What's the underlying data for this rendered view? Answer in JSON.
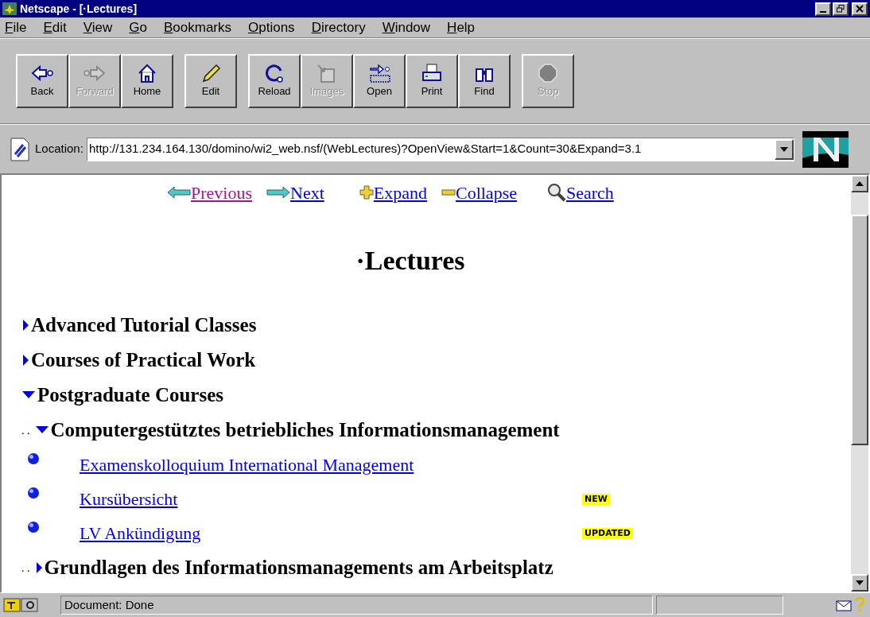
{
  "window": {
    "title": "Netscape - [·Lectures]"
  },
  "menu": [
    "File",
    "Edit",
    "View",
    "Go",
    "Bookmarks",
    "Options",
    "Directory",
    "Window",
    "Help"
  ],
  "toolbar": [
    {
      "kind": "back",
      "label": "Back",
      "disabled": false
    },
    {
      "kind": "forward",
      "label": "Forward",
      "disabled": true
    },
    {
      "kind": "home",
      "label": "Home",
      "disabled": false
    },
    {
      "kind": "edit",
      "label": "Edit",
      "disabled": false
    },
    {
      "kind": "reload",
      "label": "Reload",
      "disabled": false
    },
    {
      "kind": "images",
      "label": "Images",
      "disabled": true
    },
    {
      "kind": "open",
      "label": "Open",
      "disabled": false
    },
    {
      "kind": "print",
      "label": "Print",
      "disabled": false
    },
    {
      "kind": "find",
      "label": "Find",
      "disabled": false
    },
    {
      "kind": "stop",
      "label": "Stop",
      "disabled": true
    }
  ],
  "location": {
    "label": "Location:",
    "value": "http://131.234.164.130/domino/wi2_web.nsf/(WebLectures)?OpenView&Start=1&Count=30&Expand=3.1"
  },
  "nav_links": [
    {
      "kind": "previous",
      "label": "Previous",
      "visited": true
    },
    {
      "kind": "next",
      "label": "Next",
      "visited": false
    },
    {
      "kind": "expand",
      "label": "Expand",
      "visited": false
    },
    {
      "kind": "collapse",
      "label": "Collapse",
      "visited": false
    },
    {
      "kind": "search",
      "label": "Search",
      "visited": false
    }
  ],
  "page_title": "·Lectures",
  "tree": [
    {
      "kind": "category",
      "label": "Advanced Tutorial Classes",
      "expanded": false
    },
    {
      "kind": "category",
      "label": "Courses of Practical Work",
      "expanded": false
    },
    {
      "kind": "category",
      "label": "Postgraduate Courses",
      "expanded": true,
      "children": [
        {
          "kind": "category",
          "leader": ". .",
          "label": "Computergestütztes betriebliches Informationsmanagement",
          "expanded": true,
          "children": [
            {
              "kind": "document",
              "label": "Examenskolloquium International Management"
            },
            {
              "kind": "document",
              "label": "Kursübersicht",
              "badge": "NEW"
            },
            {
              "kind": "document",
              "label": "LV Ankündigung",
              "badge": "UPDATED"
            }
          ]
        },
        {
          "kind": "category",
          "leader": ". .",
          "label": "Grundlagen des Informationsmanagements am Arbeitsplatz",
          "expanded": false
        }
      ]
    }
  ],
  "status_bar": {
    "text": "Document: Done"
  }
}
